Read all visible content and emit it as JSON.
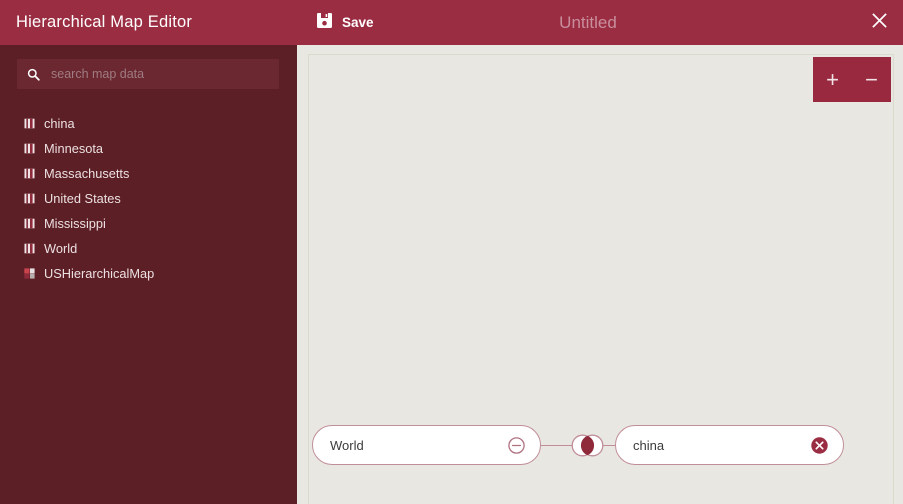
{
  "window": {
    "app_title": "Hierarchical Map Editor",
    "document_title": "Untitled",
    "close_label": "✕"
  },
  "toolbar": {
    "save_label": "Save",
    "save_icon": "floppy-disk-icon"
  },
  "sidebar": {
    "search": {
      "placeholder": "search map data",
      "value": "",
      "icon": "search-icon"
    },
    "items": [
      {
        "label": "china",
        "icon": "map-data-icon"
      },
      {
        "label": "Minnesota",
        "icon": "map-data-icon"
      },
      {
        "label": "Massachusetts",
        "icon": "map-data-icon"
      },
      {
        "label": "United States",
        "icon": "map-data-icon"
      },
      {
        "label": "Mississippi",
        "icon": "map-data-icon"
      },
      {
        "label": "World",
        "icon": "map-data-icon"
      },
      {
        "label": "USHierarchicalMap",
        "icon": "hierarchical-map-icon"
      }
    ]
  },
  "canvas": {
    "zoom_in_label": "+",
    "zoom_out_label": "−",
    "nodes": [
      {
        "id": "world",
        "label": "World",
        "action_icon": "minus-circle-icon"
      },
      {
        "id": "china",
        "label": "china",
        "action_icon": "remove-circle-icon"
      }
    ],
    "connector_icon": "link-connector-icon"
  },
  "colors": {
    "header": "#9a2d42",
    "sidebar": "#5c1f25",
    "search_field": "#6b2831",
    "canvas": "#e9e7e1",
    "accent": "#99293f",
    "node_border": "#c08e99",
    "node_fill": "#ffffff"
  }
}
